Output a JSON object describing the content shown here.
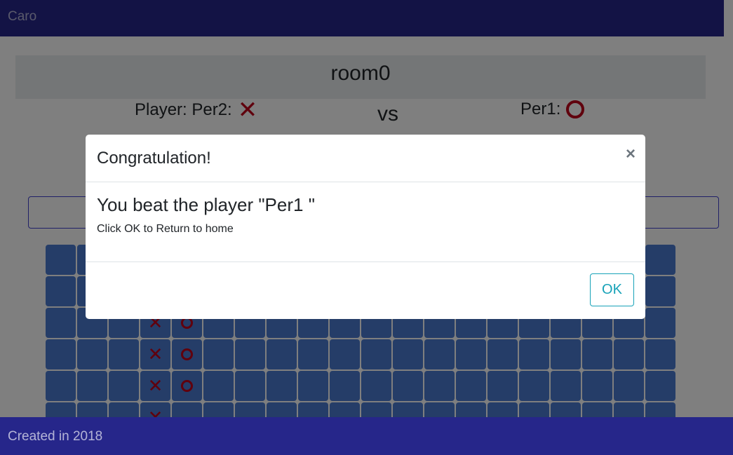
{
  "navbar": {
    "brand": "Caro"
  },
  "room": {
    "name": "room0"
  },
  "players": {
    "left_label": "Player: Per2:",
    "vs": "vs",
    "right_label": "Per1:"
  },
  "board": {
    "rows": 6,
    "cols": 20,
    "marks": [
      {
        "row": 2,
        "col": 3,
        "mark": "X"
      },
      {
        "row": 2,
        "col": 4,
        "mark": "O"
      },
      {
        "row": 3,
        "col": 3,
        "mark": "X"
      },
      {
        "row": 3,
        "col": 4,
        "mark": "O"
      },
      {
        "row": 4,
        "col": 3,
        "mark": "X"
      },
      {
        "row": 4,
        "col": 4,
        "mark": "O"
      },
      {
        "row": 5,
        "col": 3,
        "mark": "X"
      }
    ]
  },
  "modal": {
    "title": "Congratulation!",
    "close": "×",
    "message": "You beat the player \"Per1 \"",
    "sub": "Click OK to Return to home",
    "ok_label": "OK"
  },
  "footer": {
    "text": "Created in 2018"
  },
  "colors": {
    "nav": "#26268a",
    "cell": "#4a7bd0",
    "mark": "#c0001a",
    "ok": "#17a2b8"
  }
}
